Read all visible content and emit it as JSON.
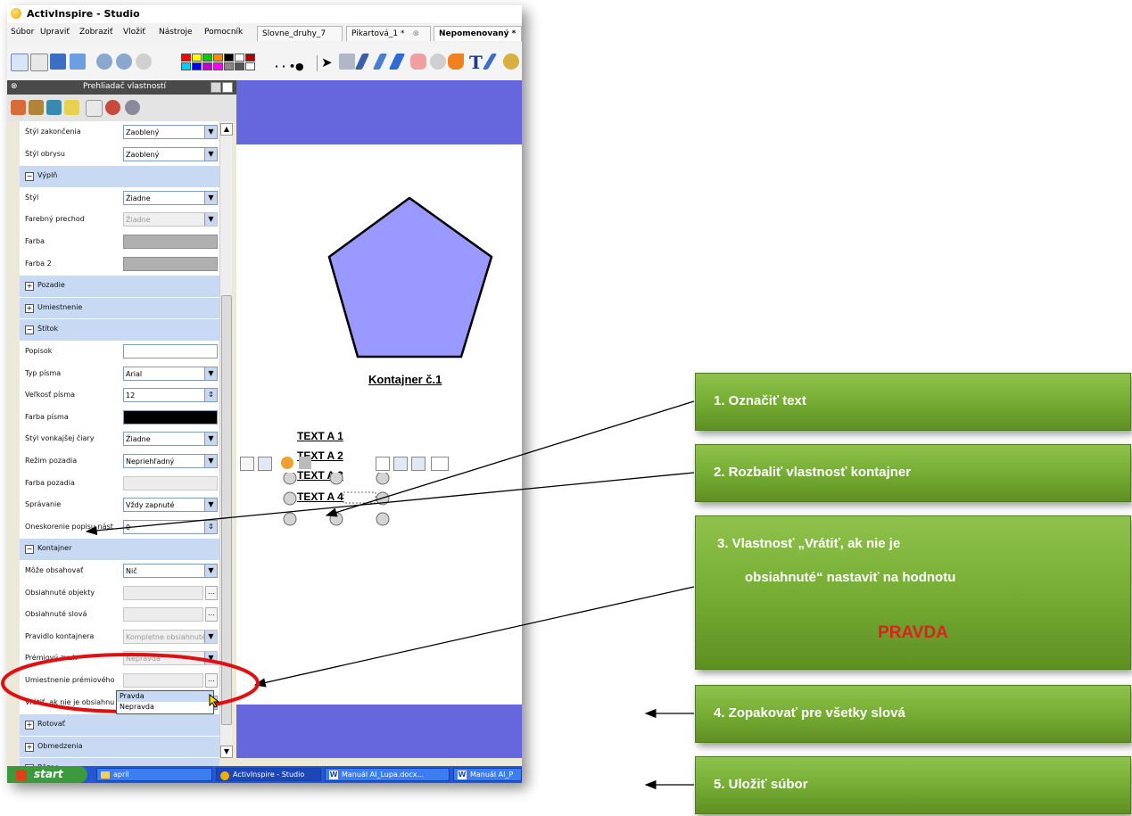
{
  "window": {
    "title": "ActivInspire - Studio"
  },
  "menu": [
    "Súbor",
    "Upraviť",
    "Zobraziť",
    "Vložiť",
    "Nástroje",
    "Pomocník"
  ],
  "tabs": [
    "Slovne_druhy_7",
    "Pikartová_1 *",
    "Nepomenovaný *"
  ],
  "panel": {
    "title": "Prehliadač vlastností"
  },
  "props": [
    {
      "type": "row",
      "label": "Štýl zakončenia",
      "value": "Zaoblený",
      "kind": "select"
    },
    {
      "type": "row",
      "label": "Štýl obrysu",
      "value": "Zaoblený",
      "kind": "select"
    },
    {
      "type": "section",
      "label": "Výplň",
      "sign": "−"
    },
    {
      "type": "row",
      "label": "Štýl",
      "value": "Žiadne",
      "kind": "select"
    },
    {
      "type": "row",
      "label": "Farebný prechod",
      "value": "Žiadne",
      "kind": "select-dis"
    },
    {
      "type": "row",
      "label": "Farba",
      "value": "",
      "kind": "grey"
    },
    {
      "type": "row",
      "label": "Farba 2",
      "value": "",
      "kind": "grey"
    },
    {
      "type": "section",
      "label": "Pozadie",
      "sign": "+"
    },
    {
      "type": "section",
      "label": "Umiestnenie",
      "sign": "+"
    },
    {
      "type": "section",
      "label": "Štítok",
      "sign": "−"
    },
    {
      "type": "row",
      "label": "Popisok",
      "value": "",
      "kind": "text"
    },
    {
      "type": "row",
      "label": "Typ písma",
      "value": "Arial",
      "kind": "select"
    },
    {
      "type": "row",
      "label": "Veľkosť písma",
      "value": "12",
      "kind": "spin"
    },
    {
      "type": "row",
      "label": "Farba písma",
      "value": "",
      "kind": "swatch"
    },
    {
      "type": "row",
      "label": "Štýl vonkajšej čiary",
      "value": "Žiadne",
      "kind": "select"
    },
    {
      "type": "row",
      "label": "Režim pozadia",
      "value": "Nepriehľadný",
      "kind": "select"
    },
    {
      "type": "row",
      "label": "Farba pozadia",
      "value": "",
      "kind": "pale"
    },
    {
      "type": "row",
      "label": "Správanie",
      "value": "Vždy zapnuté",
      "kind": "select"
    },
    {
      "type": "row",
      "label": "Oneskorenie popisu nást",
      "value": "0",
      "kind": "spin"
    },
    {
      "type": "section",
      "label": "Kontajner",
      "sign": "−"
    },
    {
      "type": "row",
      "label": "Môže obsahovať",
      "value": "Nič",
      "kind": "select"
    },
    {
      "type": "row",
      "label": "Obsiahnuté objekty",
      "value": "",
      "kind": "dots"
    },
    {
      "type": "row",
      "label": "Obsiahnuté slová",
      "value": "",
      "kind": "dots"
    },
    {
      "type": "row",
      "label": "Pravidlo kontajnera",
      "value": "Kompletne obsiahnuté",
      "kind": "select-dis"
    },
    {
      "type": "row",
      "label": "Prémiový zvuk",
      "value": "Nepravda",
      "kind": "select-dis"
    },
    {
      "type": "row",
      "label": "Umiestnenie prémiového",
      "value": "",
      "kind": "dots"
    },
    {
      "type": "row",
      "label": "Vrátiť, ak nie je obsiahnu",
      "value": "Nepravda",
      "kind": "select"
    },
    {
      "type": "section",
      "label": "Rotovať",
      "sign": "+"
    },
    {
      "type": "section",
      "label": "Obmedzenia",
      "sign": "+"
    },
    {
      "type": "section",
      "label": "Rôzne",
      "sign": "+"
    }
  ],
  "dropdown_options": [
    "Pravda",
    "Nepravda"
  ],
  "canvas": {
    "container_label": "Kontajner č.1",
    "texts": [
      "TEXT A 1",
      "TEXT A 2",
      "TEXT A 3",
      "TEXT A 4"
    ]
  },
  "taskbar": {
    "start": "start",
    "items": [
      "apríl",
      "ActivInspire - Studio",
      "Manuál AI_Lupa.docx...",
      "Manuál AI_P"
    ]
  },
  "steps": [
    "1.  Označiť  text",
    "2.  Rozbaliť vlastnosť kontajner",
    "3.  Vlastnosť  „Vrátiť, ak nie je",
    "obsiahnuté“ nastaviť na hodnotu",
    "PRAVDA",
    "4.  Zopakovať pre všetky slová",
    "5.  Uložiť súbor"
  ],
  "colors": {
    "accent_blue": "#6666dd",
    "pentagon": "#9999ff",
    "step_green": "#76ad34",
    "pravda_red": "#e02020"
  }
}
